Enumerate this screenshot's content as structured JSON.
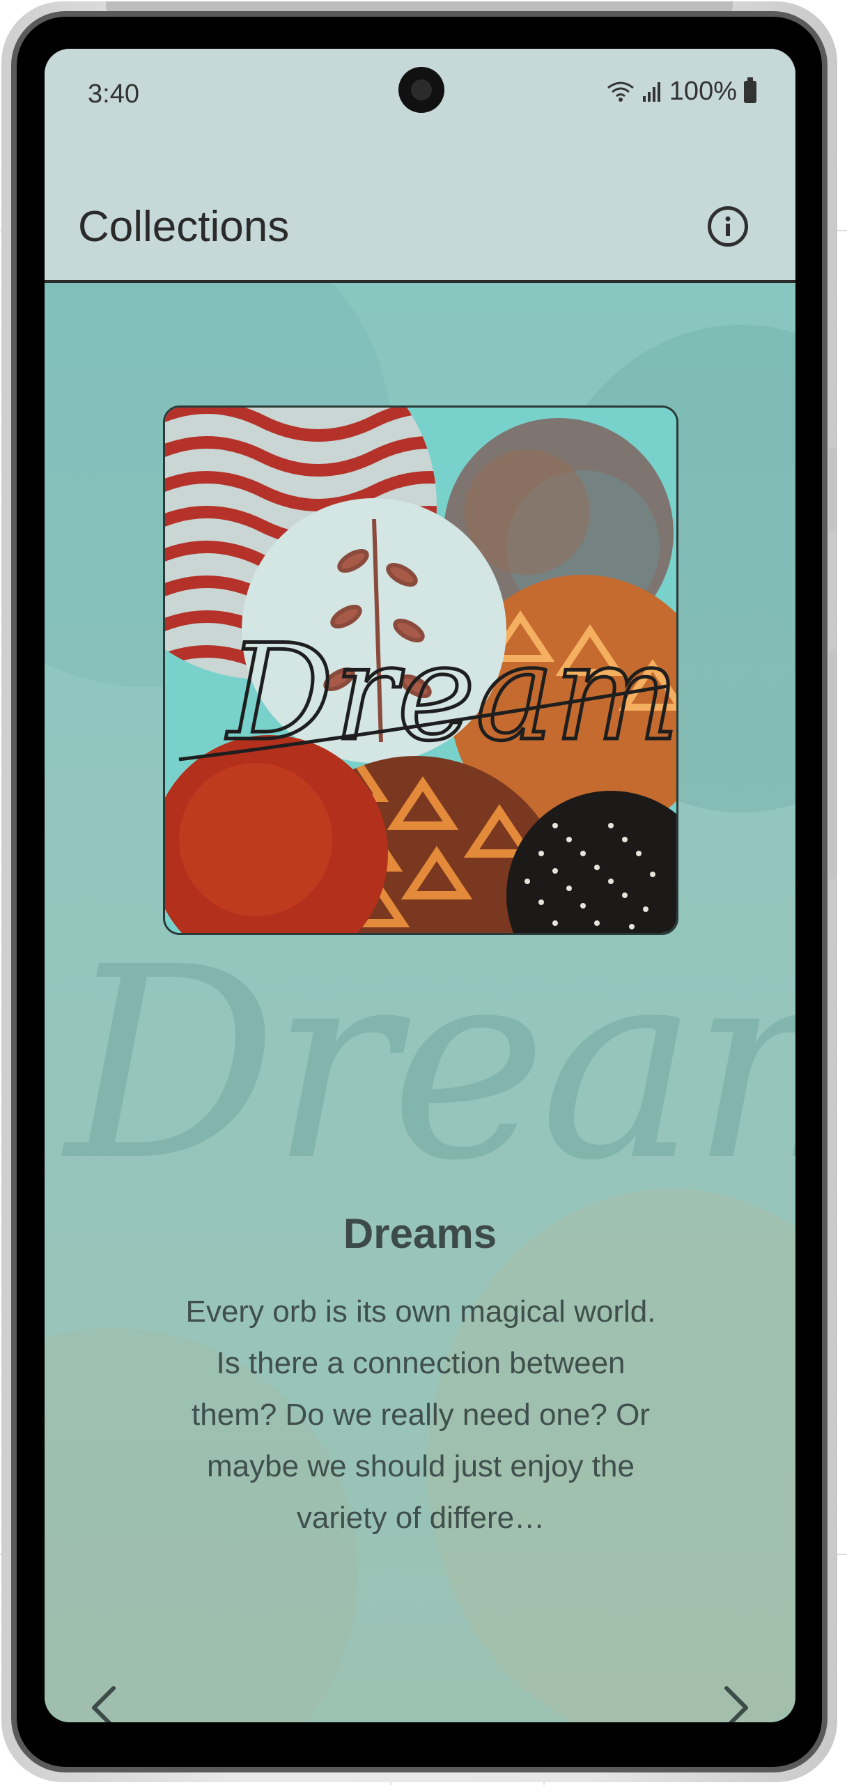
{
  "status_bar": {
    "time": "3:40",
    "battery": "100%"
  },
  "app_bar": {
    "title": "Collections",
    "info_icon": "info-icon"
  },
  "cover": {
    "script_text": "Dreams"
  },
  "collection": {
    "title": "Dreams",
    "description": "Every orb is its own magical world. Is there a connection between them? Do we really need one? Or maybe we should just enjoy the variety of differe…"
  },
  "navigation": {
    "previous_icon": "chevron-left-icon",
    "next_icon": "chevron-right-icon"
  },
  "colors": {
    "app_bar_bg": "#c6d9d8",
    "content_bg": "#8fc6bf",
    "text_dark": "#3c4a48"
  }
}
